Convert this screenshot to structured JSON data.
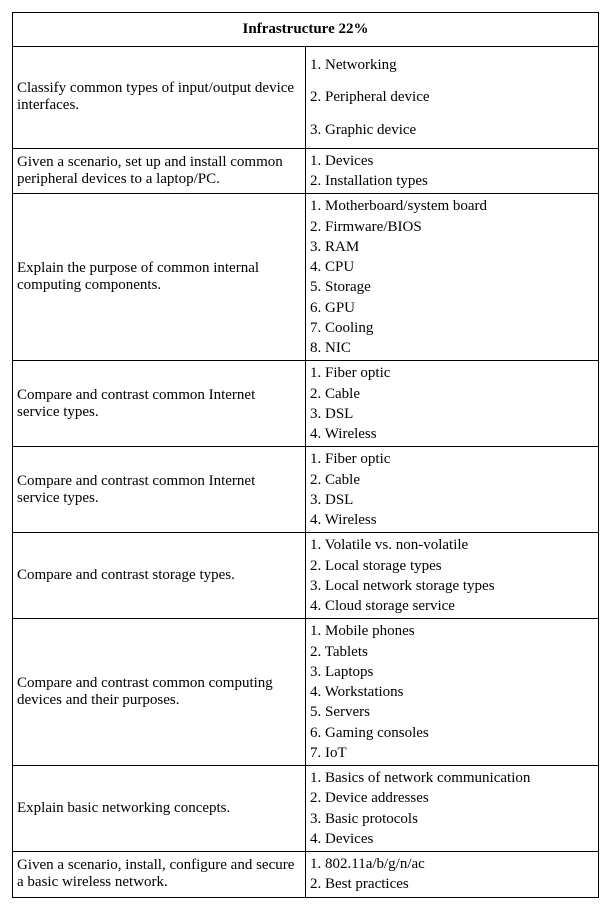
{
  "title": "Infrastructure 22%",
  "rows": [
    {
      "topic": "Classify common types of input/output device interfaces.",
      "spaced": true,
      "items": [
        "1. Networking",
        "2. Peripheral device",
        "3. Graphic device"
      ]
    },
    {
      "topic": "Given a scenario, set up and install common peripheral devices to a laptop/PC.",
      "spaced": false,
      "items": [
        "1. Devices",
        "2. Installation types"
      ]
    },
    {
      "topic": "Explain the purpose of common internal computing components.",
      "spaced": false,
      "items": [
        "1. Motherboard/system board",
        "2. Firmware/BIOS",
        "3. RAM",
        "4. CPU",
        "5. Storage",
        "6. GPU",
        "7. Cooling",
        "8. NIC"
      ]
    },
    {
      "topic": "Compare and contrast common Internet service types.",
      "spaced": false,
      "items": [
        "1. Fiber optic",
        "2. Cable",
        "3. DSL",
        "4. Wireless"
      ]
    },
    {
      "topic": "Compare and contrast common Internet service types.",
      "spaced": false,
      "items": [
        "1. Fiber optic",
        "2. Cable",
        "3. DSL",
        "4. Wireless"
      ]
    },
    {
      "topic": "Compare and contrast storage types.",
      "spaced": false,
      "items": [
        "1. Volatile vs. non-volatile",
        "2. Local storage types",
        "3. Local network storage types",
        "4. Cloud storage service"
      ]
    },
    {
      "topic": "Compare and contrast common computing devices and their purposes.",
      "spaced": false,
      "items": [
        "1. Mobile phones",
        "2. Tablets",
        "3. Laptops",
        "4. Workstations",
        "5. Servers",
        "6. Gaming consoles",
        "7. IoT"
      ]
    },
    {
      "topic": "Explain basic networking concepts.",
      "spaced": false,
      "items": [
        "1. Basics of network communication",
        "2. Device addresses",
        "3. Basic protocols",
        "4. Devices"
      ]
    },
    {
      "topic": "Given a scenario, install, configure and secure a basic wireless network.",
      "spaced": false,
      "items": [
        "1. 802.11a/b/g/n/ac",
        "2. Best practices"
      ]
    }
  ]
}
